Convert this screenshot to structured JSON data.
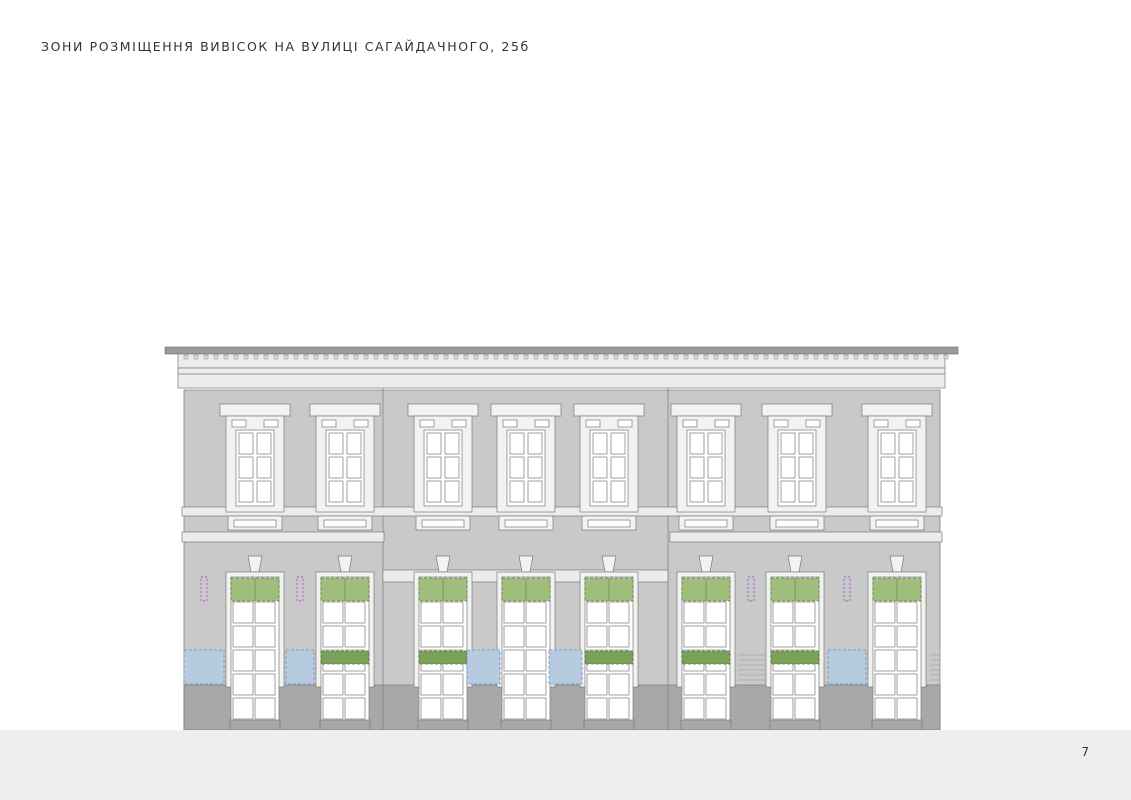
{
  "title": "ЗОНИ РОЗМІЩЕННЯ ВИВІСОК НА ВУЛИЦІ САГАЙДАЧНОГО, 25б",
  "page_number": "7",
  "colors": {
    "wall": "#c9c9c9",
    "plinth": "#a8a8a8",
    "trim": "#f2f2f2",
    "cornice": "#ececec",
    "roof": "#9a9a9a",
    "line": "#7a7a7a",
    "sign_zone_green": "#9fbd7b",
    "sign_zone_dark_green": "#7aa05a",
    "sign_zone_blue": "#b7cbe0",
    "small_sign_magenta": "#b04cc8",
    "footer": "#eeeeee"
  }
}
